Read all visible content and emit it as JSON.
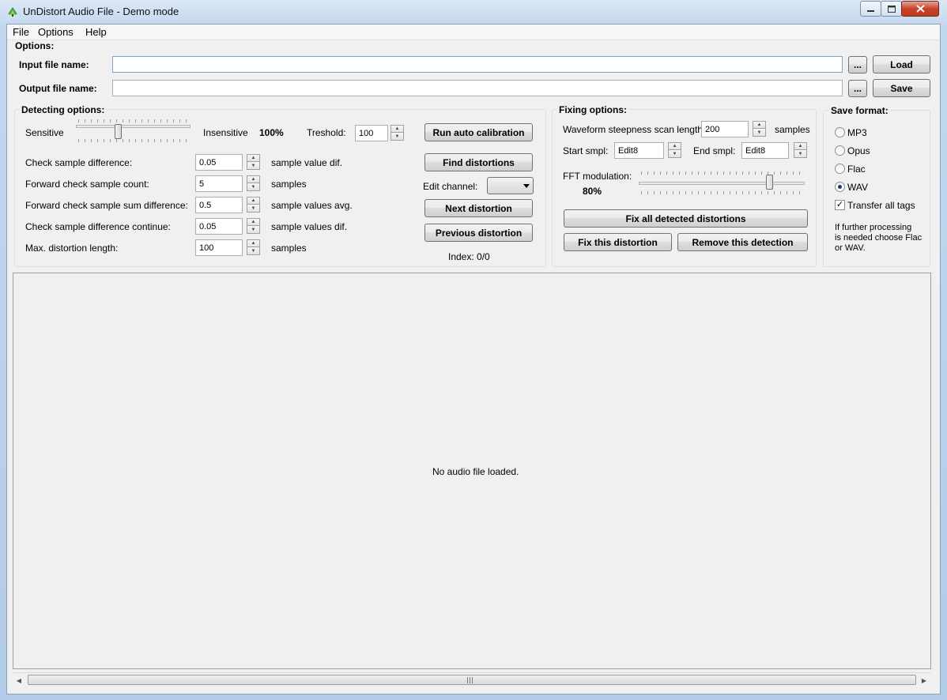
{
  "window": {
    "title": "UnDistort Audio File - Demo mode"
  },
  "menu": {
    "items": [
      "File",
      "Options",
      "Help"
    ]
  },
  "options": {
    "section_label": "Options:",
    "input_label": "Input file name:",
    "input_value": "",
    "output_label": "Output file name:",
    "output_value": "",
    "browse_label": "...",
    "load_label": "Load",
    "save_label": "Save"
  },
  "detecting": {
    "title": "Detecting options:",
    "sensitive_label": "Sensitive",
    "insensitive_label": "Insensitive",
    "sensitivity_percent": "100%",
    "sensitivity_slider_level": 0.36,
    "treshold_label": "Treshold:",
    "treshold_value": "100",
    "rows": [
      {
        "label": "Check sample difference:",
        "value": "0.05",
        "unit": "sample value dif."
      },
      {
        "label": "Forward check sample count:",
        "value": "5",
        "unit": "samples"
      },
      {
        "label": "Forward check sample sum difference:",
        "value": "0.5",
        "unit": "sample values avg."
      },
      {
        "label": "Check sample difference continue:",
        "value": "0.05",
        "unit": "sample values dif."
      },
      {
        "label": "Max. distortion length:",
        "value": "100",
        "unit": "samples"
      }
    ],
    "run_calibration_label": "Run auto calibration",
    "find_label": "Find distortions",
    "edit_channel_label": "Edit channel:",
    "next_label": "Next distortion",
    "previous_label": "Previous distortion",
    "index_text": "Index: 0/0"
  },
  "fixing": {
    "title": "Fixing options:",
    "steepness_label": "Waveform steepness scan length:",
    "steepness_value": "200",
    "steepness_unit": "samples",
    "start_label": "Start smpl:",
    "start_value": "Edit8",
    "end_label": "End smpl:",
    "end_value": "Edit8",
    "fft_label": "FFT modulation:",
    "fft_percent": "80%",
    "fft_slider_level": 0.8,
    "fix_all_label": "Fix all detected distortions",
    "fix_this_label": "Fix this distortion",
    "remove_label": "Remove this detection"
  },
  "save_format": {
    "title": "Save format:",
    "options": [
      "MP3",
      "Opus",
      "Flac",
      "WAV"
    ],
    "selected": "WAV",
    "transfer_tags_label": "Transfer all tags",
    "transfer_tags_checked": true,
    "note_lines": [
      "If further processing",
      "is needed choose Flac",
      "or WAV."
    ]
  },
  "wave": {
    "empty_text": "No audio file loaded."
  },
  "colors": {
    "accent": "#1f3a66",
    "window_bg": "#f0f0f0",
    "close_red": "#c6442a"
  }
}
